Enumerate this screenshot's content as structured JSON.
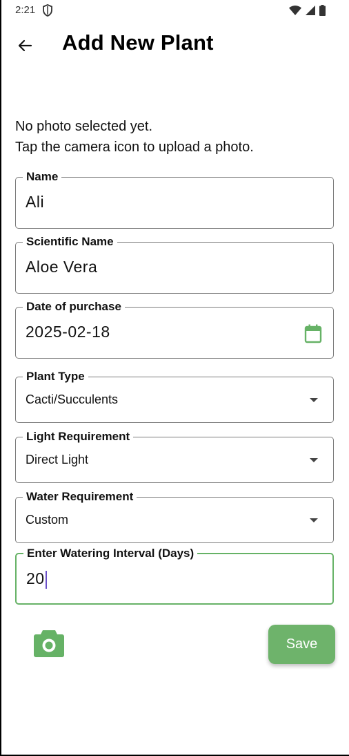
{
  "status_bar": {
    "time": "2:21",
    "icons": [
      "shield-icon",
      "wifi-icon",
      "signal-icon",
      "battery-icon"
    ]
  },
  "app_bar": {
    "title": "Add New Plant",
    "back_icon": "arrow-left-icon"
  },
  "photo": {
    "line1": "No photo selected yet.",
    "line2": "Tap the camera icon to upload a photo."
  },
  "form": {
    "name": {
      "label": "Name",
      "value": "Ali"
    },
    "scientific_name": {
      "label": "Scientific Name",
      "value": "Aloe Vera"
    },
    "date_of_purchase": {
      "label": "Date of purchase",
      "value": "2025-02-18"
    },
    "plant_type": {
      "label": "Plant Type",
      "value": "Cacti/Succulents"
    },
    "light_requirement": {
      "label": "Light Requirement",
      "value": "Direct Light"
    },
    "water_requirement": {
      "label": "Water Requirement",
      "value": "Custom"
    },
    "watering_interval": {
      "label": "Enter Watering Interval (Days)",
      "value": "20"
    }
  },
  "actions": {
    "save_label": "Save",
    "camera_icon": "camera-icon"
  },
  "colors": {
    "accent": "#6eb36b",
    "focus_border": "#66b266",
    "caret": "#6a4fc8"
  }
}
